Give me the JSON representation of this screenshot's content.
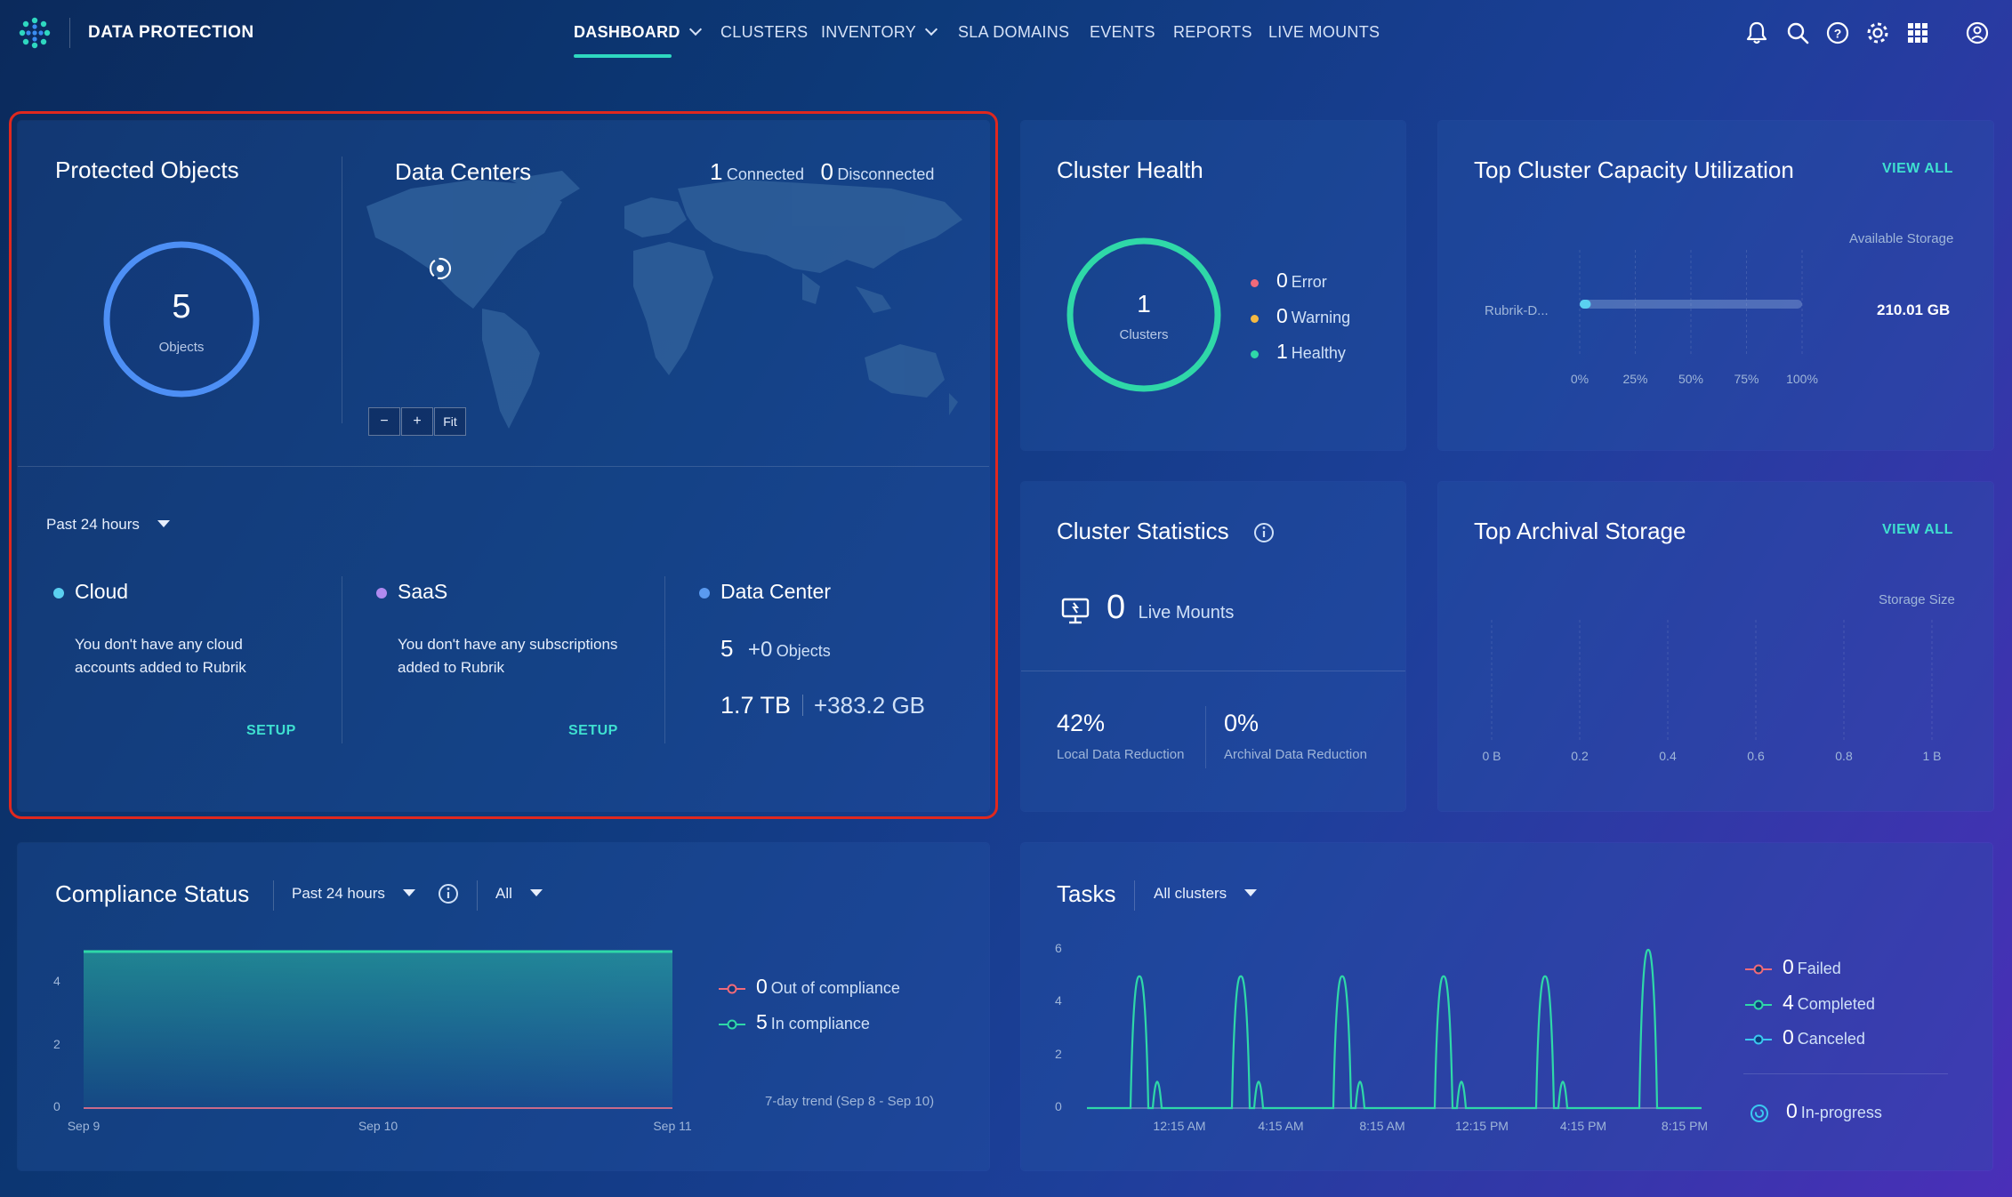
{
  "app": {
    "brand": "DATA PROTECTION"
  },
  "nav": {
    "dashboard": "DASHBOARD",
    "clusters": "CLUSTERS",
    "inventory": "INVENTORY",
    "sla_domains": "SLA DOMAINS",
    "events": "EVENTS",
    "reports": "REPORTS",
    "live_mounts": "LIVE MOUNTS"
  },
  "colors": {
    "accent": "#2fd8c0",
    "highlight_border": "#e0281e",
    "error": "#f06a7a",
    "warning": "#f5b942",
    "healthy": "#2fd8a8",
    "cloud": "#5ad0f0",
    "saas": "#b08af0",
    "datacenter": "#5a9af0"
  },
  "protected_objects": {
    "title": "Protected Objects",
    "count": "5",
    "unit": "Objects"
  },
  "data_centers": {
    "title": "Data Centers",
    "connected_count": "1",
    "connected_label": "Connected",
    "disconnected_count": "0",
    "disconnected_label": "Disconnected",
    "zoom_out": "−",
    "zoom_in": "+",
    "fit": "Fit"
  },
  "time_filter": {
    "label": "Past 24 hours"
  },
  "cloud": {
    "title": "Cloud",
    "message_line1": "You don't have any cloud",
    "message_line2": "accounts added to Rubrik",
    "action": "SETUP"
  },
  "saas": {
    "title": "SaaS",
    "message_line1": "You don't have any subscriptions",
    "message_line2": "added to Rubrik",
    "action": "SETUP"
  },
  "data_center": {
    "title": "Data Center",
    "objects_count": "5",
    "objects_delta": "+0",
    "objects_label": "Objects",
    "size": "1.7 TB",
    "size_delta": "+383.2 GB"
  },
  "cluster_health": {
    "title": "Cluster Health",
    "count": "1",
    "unit": "Clusters",
    "legend": [
      {
        "count": "0",
        "label": "Error"
      },
      {
        "count": "0",
        "label": "Warning"
      },
      {
        "count": "1",
        "label": "Healthy"
      }
    ]
  },
  "capacity": {
    "title": "Top Cluster Capacity Utilization",
    "view_all": "VIEW ALL",
    "column_label": "Available Storage",
    "row_name": "Rubrik-D...",
    "row_value": "210.01 GB",
    "ticks": [
      "0%",
      "25%",
      "50%",
      "75%",
      "100%"
    ],
    "chart_data": {
      "type": "bar",
      "categories": [
        "Rubrik-D..."
      ],
      "values": [
        0.05
      ],
      "xlim": [
        0,
        1
      ]
    }
  },
  "cluster_stats": {
    "title": "Cluster Statistics",
    "live_mounts_count": "0",
    "live_mounts_label": "Live Mounts",
    "local_reduction": "42%",
    "local_reduction_label": "Local Data Reduction",
    "archival_reduction": "0%",
    "archival_reduction_label": "Archival Data Reduction"
  },
  "archival": {
    "title": "Top Archival Storage",
    "view_all": "VIEW ALL",
    "column_label": "Storage Size",
    "ticks": [
      "0 B",
      "0.2",
      "0.4",
      "0.6",
      "0.8",
      "1 B"
    ]
  },
  "compliance": {
    "title": "Compliance Status",
    "time_filter": "Past 24 hours",
    "scope_filter": "All",
    "y_ticks": [
      "4",
      "2",
      "0"
    ],
    "x_ticks": [
      "Sep 9",
      "Sep 10",
      "Sep 11"
    ],
    "legend": [
      {
        "count": "0",
        "label": "Out of compliance"
      },
      {
        "count": "5",
        "label": "In compliance"
      }
    ],
    "trend_label": "7-day trend (Sep 8 - Sep 10)",
    "chart_data": {
      "type": "area",
      "x": [
        "Sep 9",
        "Sep 10",
        "Sep 11"
      ],
      "series": [
        {
          "name": "In compliance",
          "values": [
            5,
            5,
            5
          ]
        },
        {
          "name": "Out of compliance",
          "values": [
            0,
            0,
            0
          ]
        }
      ],
      "ylim": [
        0,
        5
      ]
    }
  },
  "tasks": {
    "title": "Tasks",
    "filter": "All clusters",
    "y_ticks": [
      "6",
      "4",
      "2",
      "0"
    ],
    "x_ticks": [
      "12:15 AM",
      "4:15 AM",
      "8:15 AM",
      "12:15 PM",
      "4:15 PM",
      "8:15 PM"
    ],
    "legend": [
      {
        "count": "0",
        "label": "Failed"
      },
      {
        "count": "4",
        "label": "Completed"
      },
      {
        "count": "0",
        "label": "Canceled"
      }
    ],
    "in_progress": {
      "count": "0",
      "label": "In-progress"
    },
    "chart_data": {
      "type": "line",
      "ylim": [
        0,
        6
      ],
      "series": [
        {
          "name": "Completed",
          "peaks": [
            5,
            1,
            5,
            1,
            5,
            1,
            5,
            1,
            5,
            1,
            6
          ]
        }
      ]
    }
  }
}
